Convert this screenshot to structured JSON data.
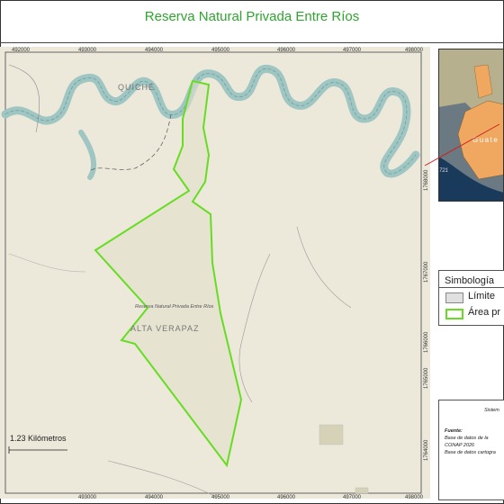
{
  "title": "Reserva Natural Privada Entre Ríos",
  "map": {
    "x_coords": [
      "492000",
      "493000",
      "494000",
      "495000",
      "496000",
      "497000",
      "498000"
    ],
    "y_coords": [
      "1768000",
      "1767000",
      "1766000",
      "1765000",
      "1764000"
    ],
    "labels": {
      "region_north": "QUICHÉ",
      "region_south": "ALTA VERAPAZ",
      "reserve_label": "Reserva Natural Privada Entre Ríos"
    },
    "colors": {
      "land": "#ece8da",
      "river": "#9fc6c3",
      "reserve_outline": "#66dd22",
      "roads": "#888888"
    }
  },
  "inset": {
    "country_label": "Guate",
    "road_label": "721",
    "colors": {
      "fill": "#f0a860",
      "sea": "#1a3a5c",
      "pointer": "#cc2222"
    }
  },
  "legend": {
    "title": "Simbología",
    "items": [
      {
        "label": "Límite",
        "color": "#e0e0e0"
      },
      {
        "label": "Área pr",
        "color": "#66dd22"
      }
    ]
  },
  "sources": {
    "heading": "Fuente:",
    "line1": "Base de datos de la",
    "line2": "CONAP 2026",
    "line3": "Base de datos cartogra"
  },
  "system_label": "Sistem",
  "scale": {
    "label": "1.23 Kilómetros"
  }
}
